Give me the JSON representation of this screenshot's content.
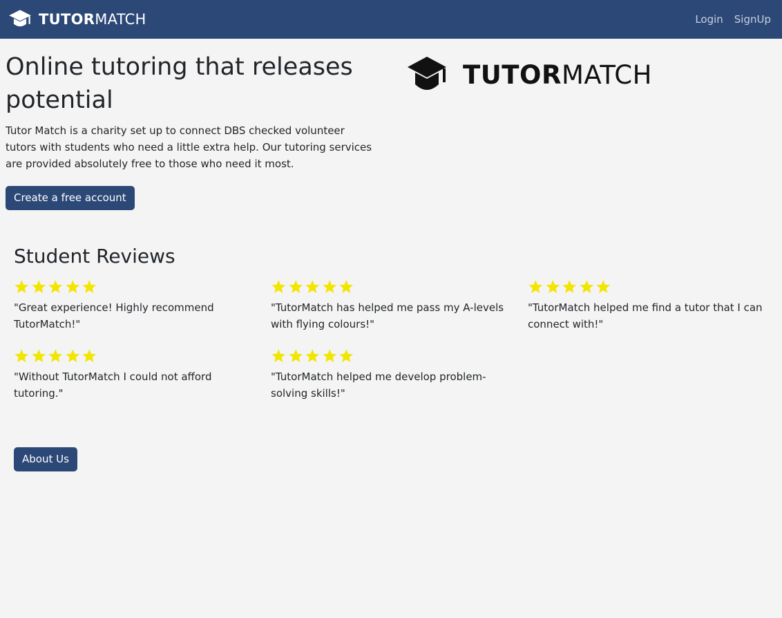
{
  "navbar": {
    "brand_bold": "TUTOR",
    "brand_rest": "MATCH",
    "links": [
      "Login",
      "SignUp"
    ]
  },
  "hero": {
    "title": "Online tutoring that releases potential",
    "description": "Tutor Match is a charity set up to connect DBS checked volunteer tutors with students who need a little extra help. Our tutoring services are provided absolutely free to those who need it most.",
    "cta_label": "Create a free account",
    "logo_bold": "TUTOR",
    "logo_rest": "MATCH"
  },
  "reviews": {
    "title": "Student Reviews",
    "items": [
      {
        "rating": 5,
        "text": "\"Great experience! Highly recommend TutorMatch!\""
      },
      {
        "rating": 5,
        "text": "\"TutorMatch has helped me pass my A-levels with flying colours!\""
      },
      {
        "rating": 5,
        "text": "\"TutorMatch helped me find a tutor that I can connect with!\""
      },
      {
        "rating": 5,
        "text": "\"Without TutorMatch I could not afford tutoring.\""
      },
      {
        "rating": 5,
        "text": "\"TutorMatch helped me develop problem-solving skills!\""
      }
    ]
  },
  "about_label": "About Us",
  "colors": {
    "navbar": "#2c4877",
    "button": "#2c4877",
    "star": "#f2e600",
    "background": "#f4f4f4"
  },
  "icons": {
    "brand": "graduation-cap-icon",
    "rating": "star-icon"
  }
}
